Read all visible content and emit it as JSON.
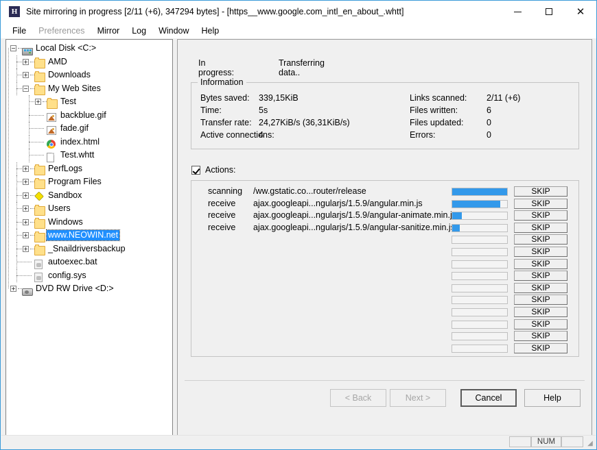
{
  "window": {
    "title": "Site mirroring in progress [2/11 (+6), 347294 bytes] - [https__www.google.com_intl_en_about_.whtt]",
    "app_icon": "httrack-h-icon",
    "minimize_label": "minimize-icon",
    "maximize_label": "maximize-icon",
    "close_label": "✕"
  },
  "menu": [
    {
      "label": "File",
      "disabled": false
    },
    {
      "label": "Preferences",
      "disabled": true
    },
    {
      "label": "Mirror",
      "disabled": false
    },
    {
      "label": "Log",
      "disabled": false
    },
    {
      "label": "Window",
      "disabled": false
    },
    {
      "label": "Help",
      "disabled": false
    }
  ],
  "tree": [
    {
      "label": "Local Disk <C:>",
      "depth": 0,
      "icon": "drive-icon",
      "expander": "minus",
      "selected": false
    },
    {
      "label": "AMD",
      "depth": 1,
      "icon": "folder-icon",
      "expander": "plus",
      "selected": false
    },
    {
      "label": "Downloads",
      "depth": 1,
      "icon": "folder-icon",
      "expander": "plus",
      "selected": false
    },
    {
      "label": "My Web Sites",
      "depth": 1,
      "icon": "folder-icon",
      "expander": "minus",
      "selected": false
    },
    {
      "label": "Test",
      "depth": 2,
      "icon": "folder-icon",
      "expander": "plus",
      "selected": false
    },
    {
      "label": "backblue.gif",
      "depth": 2,
      "icon": "image-icon",
      "expander": "none",
      "selected": false
    },
    {
      "label": "fade.gif",
      "depth": 2,
      "icon": "image-icon",
      "expander": "none",
      "selected": false
    },
    {
      "label": "index.html",
      "depth": 2,
      "icon": "chrome-icon",
      "expander": "none",
      "selected": false
    },
    {
      "label": "Test.whtt",
      "depth": 2,
      "icon": "page-icon",
      "expander": "none",
      "selected": false
    },
    {
      "label": "PerfLogs",
      "depth": 1,
      "icon": "folder-icon",
      "expander": "plus",
      "selected": false
    },
    {
      "label": "Program Files",
      "depth": 1,
      "icon": "folder-icon",
      "expander": "plus",
      "selected": false
    },
    {
      "label": "Sandbox",
      "depth": 1,
      "icon": "sandbox-icon",
      "expander": "plus",
      "selected": false
    },
    {
      "label": "Users",
      "depth": 1,
      "icon": "folder-icon",
      "expander": "plus",
      "selected": false
    },
    {
      "label": "Windows",
      "depth": 1,
      "icon": "folder-icon",
      "expander": "plus",
      "selected": false
    },
    {
      "label": "www.NEOWIN.net",
      "depth": 1,
      "icon": "folder-icon",
      "expander": "plus",
      "selected": true
    },
    {
      "label": "_Snaildriversbackup",
      "depth": 1,
      "icon": "folder-icon",
      "expander": "plus",
      "selected": false
    },
    {
      "label": "autoexec.bat",
      "depth": 1,
      "icon": "sysfile-icon",
      "expander": "none",
      "selected": false
    },
    {
      "label": "config.sys",
      "depth": 1,
      "icon": "sysfile-icon",
      "expander": "none",
      "selected": false
    },
    {
      "label": "DVD RW Drive <D:>",
      "depth": 0,
      "icon": "dvd-icon",
      "expander": "plus",
      "selected": false
    }
  ],
  "progress": {
    "label": "In progress:",
    "value": "Transferring data.."
  },
  "information": {
    "title": "Information",
    "left": [
      {
        "label": "Bytes saved:",
        "value": "339,15KiB"
      },
      {
        "label": "Time:",
        "value": "5s"
      },
      {
        "label": "Transfer rate:",
        "value": "24,27KiB/s (36,31KiB/s)"
      },
      {
        "label": "Active connections:",
        "value": "4"
      }
    ],
    "right": [
      {
        "label": "Links scanned:",
        "value": "2/11 (+6)"
      },
      {
        "label": "Files written:",
        "value": "6"
      },
      {
        "label": "Files updated:",
        "value": "0"
      },
      {
        "label": "Errors:",
        "value": "0"
      }
    ]
  },
  "actions": {
    "checkbox_label": "Actions:",
    "checked": true,
    "skip_label": "SKIP",
    "bar_color": "#3399ea",
    "rows": [
      {
        "state": "scanning",
        "url": "/ww.gstatic.co...router/release",
        "percent": 100
      },
      {
        "state": "receive",
        "url": "ajax.googleapi...ngularjs/1.5.9/angular.min.js",
        "percent": 88
      },
      {
        "state": "receive",
        "url": "ajax.googleapi...ngularjs/1.5.9/angular-animate.min.js",
        "percent": 18
      },
      {
        "state": "receive",
        "url": "ajax.googleapi...ngularjs/1.5.9/angular-sanitize.min.js",
        "percent": 14
      },
      {
        "state": "",
        "url": "",
        "percent": 0
      },
      {
        "state": "",
        "url": "",
        "percent": 0
      },
      {
        "state": "",
        "url": "",
        "percent": 0
      },
      {
        "state": "",
        "url": "",
        "percent": 0
      },
      {
        "state": "",
        "url": "",
        "percent": 0
      },
      {
        "state": "",
        "url": "",
        "percent": 0
      },
      {
        "state": "",
        "url": "",
        "percent": 0
      },
      {
        "state": "",
        "url": "",
        "percent": 0
      },
      {
        "state": "",
        "url": "",
        "percent": 0
      },
      {
        "state": "",
        "url": "",
        "percent": 0
      }
    ]
  },
  "buttons": {
    "back": {
      "label": "< Back",
      "disabled": true,
      "default": false
    },
    "next": {
      "label": "Next >",
      "disabled": true,
      "default": false
    },
    "cancel": {
      "label": "Cancel",
      "disabled": false,
      "default": true
    },
    "help": {
      "label": "Help",
      "disabled": false,
      "default": false
    }
  },
  "statusbar": {
    "cell1": "",
    "num": "NUM",
    "cell3": "",
    "grip": "resize-grip-icon"
  }
}
